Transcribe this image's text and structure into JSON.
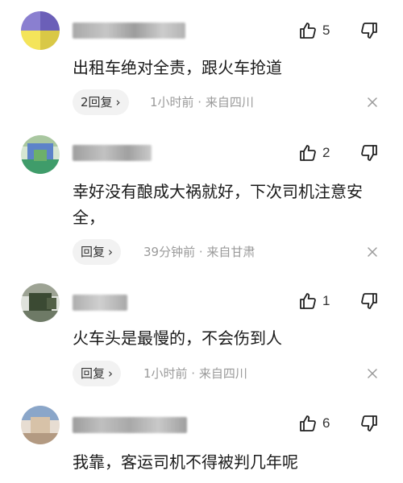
{
  "comments": [
    {
      "likes": "5",
      "text": "出租车绝对全责，跟火车抢道",
      "reply_label": "2回复",
      "meta": "1小时前 · 来自四川",
      "avatar_colors": [
        "#6b5fb8",
        "#f4e45a",
        "#d9c846",
        "#9a8fd6"
      ]
    },
    {
      "likes": "2",
      "text": "幸好没有酿成大祸就好，下次司机注意安全，",
      "reply_label": "回复",
      "meta": "39分钟前 · 来自甘肃",
      "avatar_colors": [
        "#3f9c6a",
        "#5d83c9",
        "#a9c7a0",
        "#6db06a"
      ]
    },
    {
      "likes": "1",
      "text": "火车头是最慢的，不会伤到人",
      "reply_label": "回复",
      "meta": "1小时前 · 来自四川",
      "avatar_colors": [
        "#3b4a33",
        "#6e7a66",
        "#9da394",
        "#526046"
      ]
    },
    {
      "likes": "6",
      "text": "我靠，客运司机不得被判几年呢",
      "reply_label": "",
      "meta": "",
      "avatar_colors": [
        "#c9b8a6",
        "#8aa6c9",
        "#d7c2a8",
        "#b39a82"
      ]
    }
  ],
  "icons": {
    "like": "thumb-up-icon",
    "dislike": "thumb-down-icon",
    "close": "close-icon",
    "chevron": "chevron-right-icon"
  },
  "colors": {
    "text": "#1a1a1a",
    "meta": "#9a9a9a",
    "reply_bg": "#f2f2f2"
  },
  "symbols": {
    "chevron": "›"
  }
}
